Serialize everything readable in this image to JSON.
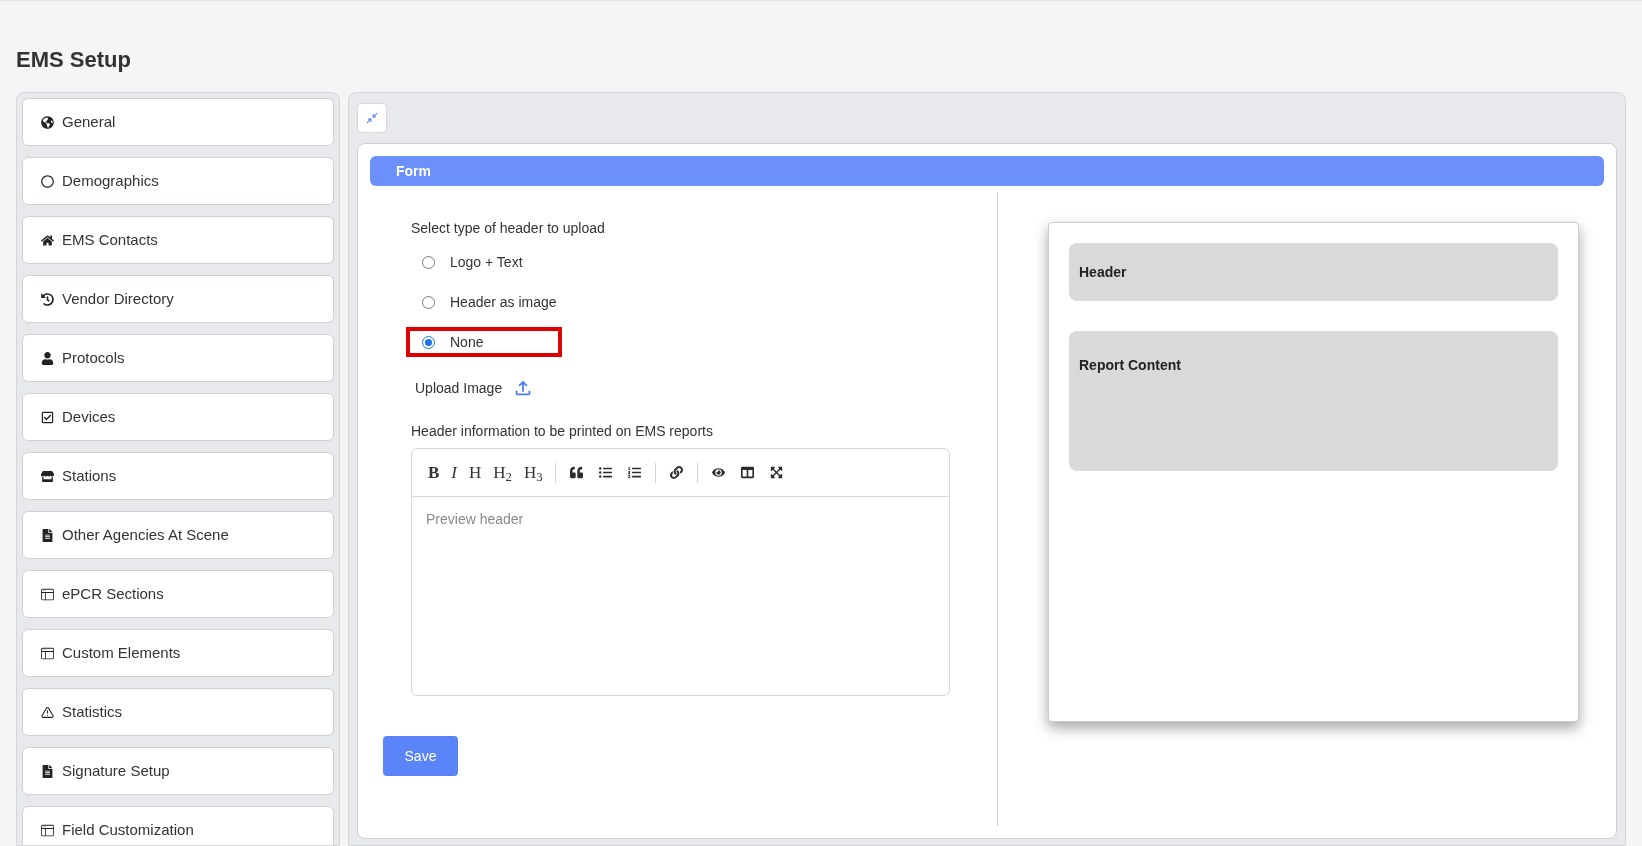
{
  "page_title": "EMS Setup",
  "sidebar": {
    "items": [
      {
        "label": "General",
        "selected": false
      },
      {
        "label": "Demographics",
        "selected": false
      },
      {
        "label": "EMS Contacts",
        "selected": false
      },
      {
        "label": "Vendor Directory",
        "selected": false
      },
      {
        "label": "Protocols",
        "selected": false
      },
      {
        "label": "Devices",
        "selected": false
      },
      {
        "label": "Stations",
        "selected": false
      },
      {
        "label": "Other Agencies At Scene",
        "selected": false
      },
      {
        "label": "ePCR Sections",
        "selected": false
      },
      {
        "label": "Custom Elements",
        "selected": false
      },
      {
        "label": "Statistics",
        "selected": false
      },
      {
        "label": "Signature Setup",
        "selected": false
      },
      {
        "label": "Field Customization",
        "selected": false
      }
    ]
  },
  "form": {
    "title": "Form",
    "header_type_label": "Select type of header to upload",
    "options": [
      {
        "label": "Logo + Text",
        "selected": false,
        "highlighted": false
      },
      {
        "label": "Header as image",
        "selected": false,
        "highlighted": false
      },
      {
        "label": "None",
        "selected": true,
        "highlighted": true
      }
    ],
    "upload_label": "Upload Image",
    "editor_label": "Header information to be printed on EMS reports",
    "editor_text_buttons": [
      "B",
      "I",
      "H",
      "H$_{2}$",
      "H$_{3}$"
    ],
    "editor_placeholder": "Preview header",
    "save_button": "Save"
  },
  "preview": {
    "sections": [
      "Header",
      "Report Content"
    ]
  }
}
